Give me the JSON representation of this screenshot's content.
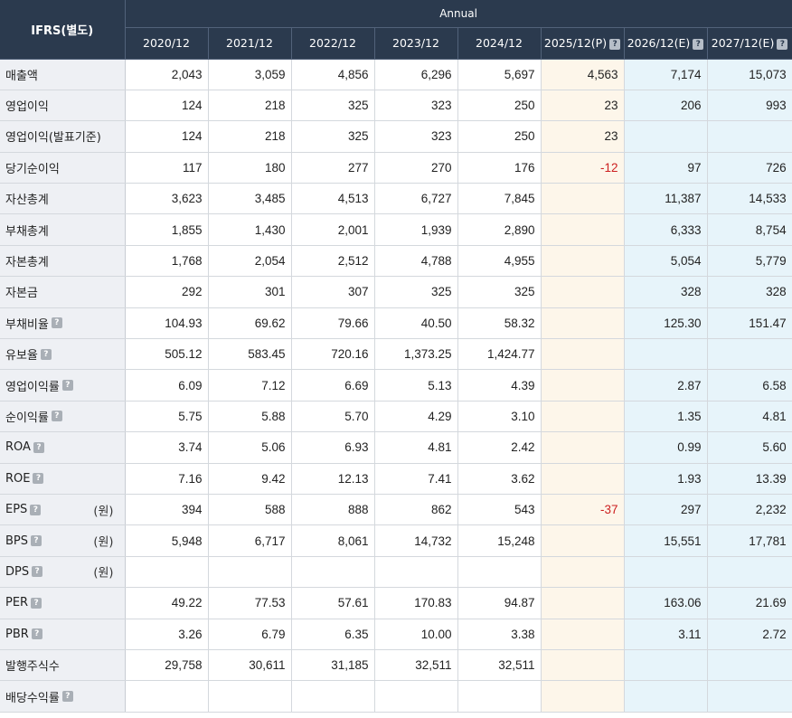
{
  "header": {
    "corner_label": "IFRS(별도)",
    "group_label": "Annual",
    "columns": [
      "2020/12",
      "2021/12",
      "2022/12",
      "2023/12",
      "2024/12",
      "2025/12(P)",
      "2026/12(E)",
      "2027/12(E)"
    ],
    "column_kinds": [
      "actual",
      "actual",
      "actual",
      "actual",
      "actual",
      "provisional",
      "estimate",
      "estimate"
    ],
    "columns_with_help": [
      false,
      false,
      false,
      false,
      false,
      true,
      true,
      true
    ],
    "help_icon_glyph": "?"
  },
  "colors": {
    "header_bg": "#2b3a4e",
    "label_bg": "#eef0f4",
    "provisional_bg": "#fdf6ea",
    "estimate_bg": "#e7f4fa",
    "negative_text": "#cc1f1f"
  },
  "rows": [
    {
      "label": "매출액",
      "help": false,
      "unit": "",
      "values": [
        "2,043",
        "3,059",
        "4,856",
        "6,296",
        "5,697",
        "4,563",
        "7,174",
        "15,073"
      ]
    },
    {
      "label": "영업이익",
      "help": false,
      "unit": "",
      "values": [
        "124",
        "218",
        "325",
        "323",
        "250",
        "23",
        "206",
        "993"
      ]
    },
    {
      "label": "영업이익(발표기준)",
      "help": false,
      "unit": "",
      "values": [
        "124",
        "218",
        "325",
        "323",
        "250",
        "23",
        "",
        ""
      ]
    },
    {
      "label": "당기순이익",
      "help": false,
      "unit": "",
      "values": [
        "117",
        "180",
        "277",
        "270",
        "176",
        "-12",
        "97",
        "726"
      ]
    },
    {
      "label": "자산총계",
      "help": false,
      "unit": "",
      "values": [
        "3,623",
        "3,485",
        "4,513",
        "6,727",
        "7,845",
        "",
        "11,387",
        "14,533"
      ]
    },
    {
      "label": "부채총계",
      "help": false,
      "unit": "",
      "values": [
        "1,855",
        "1,430",
        "2,001",
        "1,939",
        "2,890",
        "",
        "6,333",
        "8,754"
      ]
    },
    {
      "label": "자본총계",
      "help": false,
      "unit": "",
      "values": [
        "1,768",
        "2,054",
        "2,512",
        "4,788",
        "4,955",
        "",
        "5,054",
        "5,779"
      ]
    },
    {
      "label": "자본금",
      "help": false,
      "unit": "",
      "values": [
        "292",
        "301",
        "307",
        "325",
        "325",
        "",
        "328",
        "328"
      ]
    },
    {
      "label": "부채비율",
      "help": true,
      "unit": "",
      "values": [
        "104.93",
        "69.62",
        "79.66",
        "40.50",
        "58.32",
        "",
        "125.30",
        "151.47"
      ]
    },
    {
      "label": "유보율",
      "help": true,
      "unit": "",
      "values": [
        "505.12",
        "583.45",
        "720.16",
        "1,373.25",
        "1,424.77",
        "",
        "",
        ""
      ]
    },
    {
      "label": "영업이익률",
      "help": true,
      "unit": "",
      "values": [
        "6.09",
        "7.12",
        "6.69",
        "5.13",
        "4.39",
        "",
        "2.87",
        "6.58"
      ]
    },
    {
      "label": "순이익률",
      "help": true,
      "unit": "",
      "values": [
        "5.75",
        "5.88",
        "5.70",
        "4.29",
        "3.10",
        "",
        "1.35",
        "4.81"
      ]
    },
    {
      "label": "ROA",
      "help": true,
      "unit": "",
      "values": [
        "3.74",
        "5.06",
        "6.93",
        "4.81",
        "2.42",
        "",
        "0.99",
        "5.60"
      ]
    },
    {
      "label": "ROE",
      "help": true,
      "unit": "",
      "values": [
        "7.16",
        "9.42",
        "12.13",
        "7.41",
        "3.62",
        "",
        "1.93",
        "13.39"
      ]
    },
    {
      "label": "EPS",
      "help": true,
      "unit": "(원)",
      "values": [
        "394",
        "588",
        "888",
        "862",
        "543",
        "-37",
        "297",
        "2,232"
      ]
    },
    {
      "label": "BPS",
      "help": true,
      "unit": "(원)",
      "values": [
        "5,948",
        "6,717",
        "8,061",
        "14,732",
        "15,248",
        "",
        "15,551",
        "17,781"
      ]
    },
    {
      "label": "DPS",
      "help": true,
      "unit": "(원)",
      "values": [
        "",
        "",
        "",
        "",
        "",
        "",
        "",
        ""
      ]
    },
    {
      "label": "PER",
      "help": true,
      "unit": "",
      "values": [
        "49.22",
        "77.53",
        "57.61",
        "170.83",
        "94.87",
        "",
        "163.06",
        "21.69"
      ]
    },
    {
      "label": "PBR",
      "help": true,
      "unit": "",
      "values": [
        "3.26",
        "6.79",
        "6.35",
        "10.00",
        "3.38",
        "",
        "3.11",
        "2.72"
      ]
    },
    {
      "label": "발행주식수",
      "help": false,
      "unit": "",
      "values": [
        "29,758",
        "30,611",
        "31,185",
        "32,511",
        "32,511",
        "",
        "",
        ""
      ]
    },
    {
      "label": "배당수익률",
      "help": true,
      "unit": "",
      "values": [
        "",
        "",
        "",
        "",
        "",
        "",
        "",
        ""
      ]
    }
  ]
}
